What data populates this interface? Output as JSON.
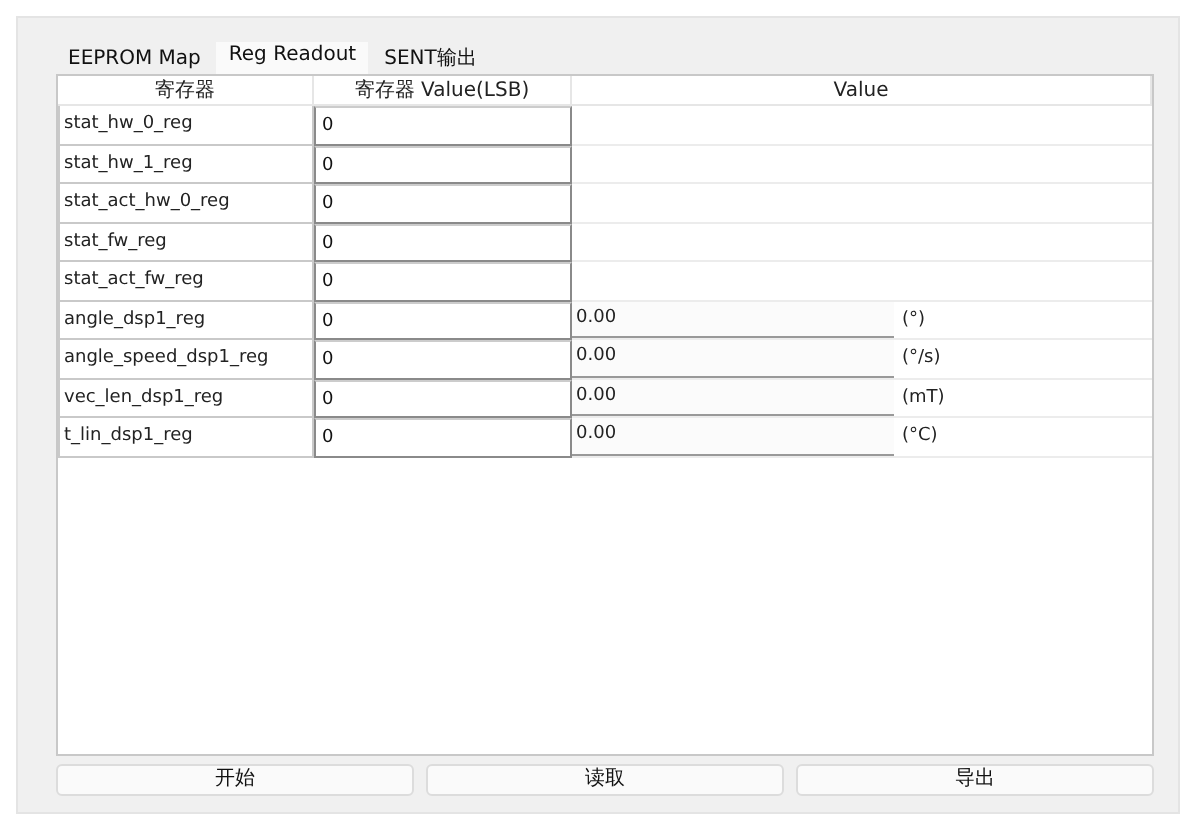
{
  "tabs": [
    {
      "label": "EEPROM Map",
      "selected": false
    },
    {
      "label": "Reg Readout",
      "selected": true
    },
    {
      "label": "SENT输出",
      "selected": false
    }
  ],
  "table": {
    "columns": [
      "寄存器",
      "寄存器 Value(LSB)",
      "Value"
    ],
    "rows": [
      {
        "kind": "plain",
        "name": "stat_hw_0_reg",
        "lsb": "0"
      },
      {
        "kind": "plain",
        "name": "stat_hw_1_reg",
        "lsb": "0"
      },
      {
        "kind": "plain",
        "name": "stat_act_hw_0_reg",
        "lsb": "0"
      },
      {
        "kind": "plain",
        "name": "stat_fw_reg",
        "lsb": "0"
      },
      {
        "kind": "plain",
        "name": "stat_act_fw_reg",
        "lsb": "0"
      },
      {
        "kind": "measured",
        "name": "angle_dsp1_reg",
        "lsb": "0",
        "value": "0.00",
        "unit": "(°)"
      },
      {
        "kind": "measured",
        "name": "angle_speed_dsp1_reg",
        "lsb": "0",
        "value": "0.00",
        "unit": "(°/s)"
      },
      {
        "kind": "measured",
        "name": "vec_len_dsp1_reg",
        "lsb": "0",
        "value": "0.00",
        "unit": "(mT)"
      },
      {
        "kind": "measured",
        "name": "t_lin_dsp1_reg",
        "lsb": "0",
        "value": "0.00",
        "unit": "(°C)"
      }
    ]
  },
  "buttons": [
    "开始",
    "读取",
    "导出"
  ]
}
